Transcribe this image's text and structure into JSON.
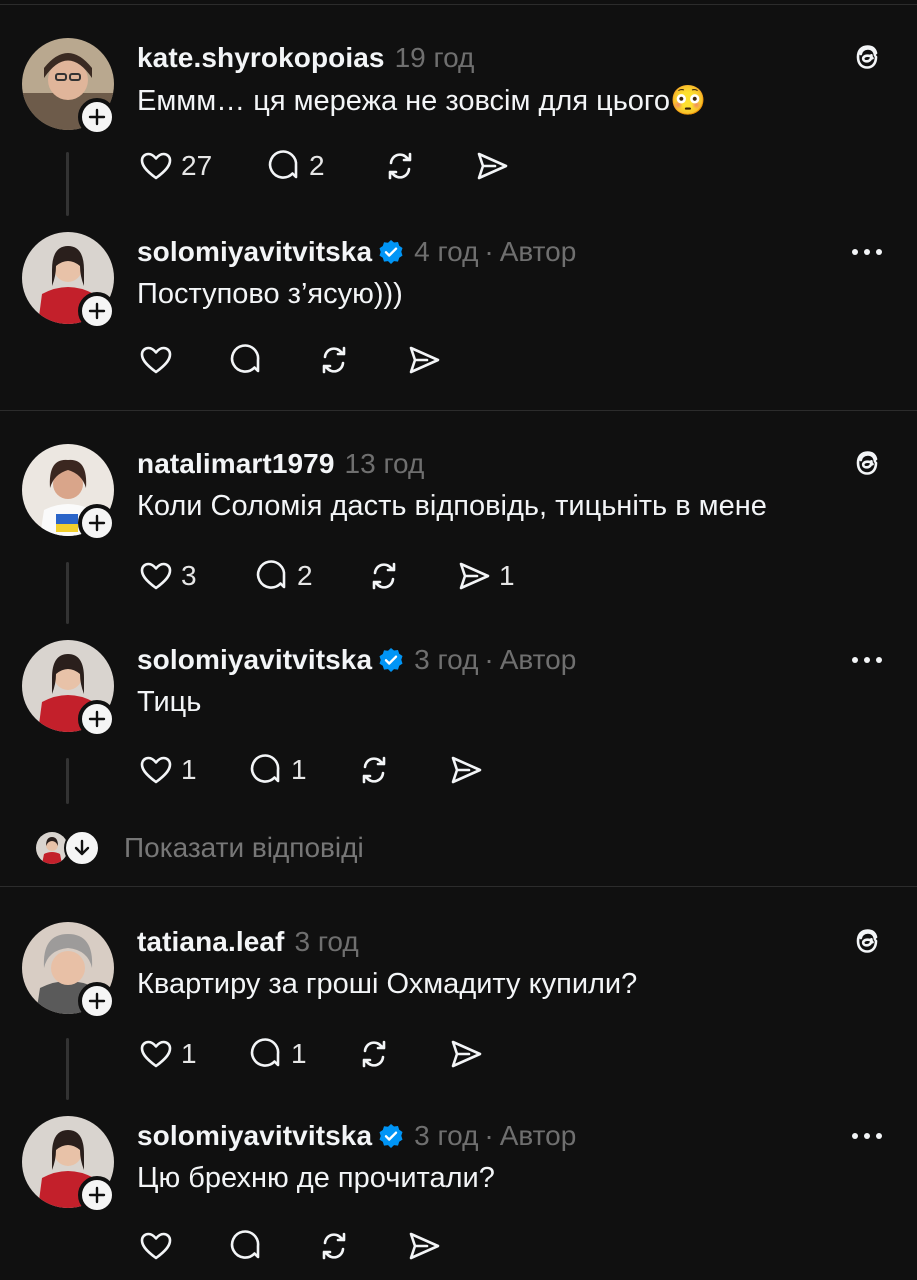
{
  "comments": [
    {
      "id": "c1",
      "username": "kate.shyrokopoias",
      "time": "19 год",
      "text": "Еммм… ця мережа не зовсім для цього😳",
      "likes": "27",
      "replies": "2",
      "reposts": "",
      "shares": "",
      "verified": false,
      "corner_icon": "threads-icon"
    },
    {
      "id": "c2",
      "username": "solomiyavitvitska",
      "time": "4 год",
      "author_label": "Автор",
      "text": "Поступово з’ясую)))",
      "likes": "",
      "replies": "",
      "reposts": "",
      "shares": "",
      "verified": true,
      "corner_icon": "more-icon"
    },
    {
      "id": "c3",
      "username": "natalimart1979",
      "time": "13 год",
      "text": "Коли Соломія дасть відповідь, тицьніть в мене",
      "likes": "3",
      "replies": "2",
      "reposts": "",
      "shares": "1",
      "verified": false,
      "corner_icon": "threads-icon"
    },
    {
      "id": "c4",
      "username": "solomiyavitvitska",
      "time": "3 год",
      "author_label": "Автор",
      "text": "Тиць",
      "likes": "1",
      "replies": "1",
      "reposts": "",
      "shares": "",
      "verified": true,
      "corner_icon": "more-icon"
    },
    {
      "id": "c5",
      "username": "tatiana.leaf",
      "time": "3 год",
      "text": "Квартиру за гроші Охмадиту купили?",
      "likes": "1",
      "replies": "1",
      "reposts": "",
      "shares": "",
      "verified": false,
      "corner_icon": "threads-icon"
    },
    {
      "id": "c6",
      "username": "solomiyavitvitska",
      "time": "3 год",
      "author_label": "Автор",
      "text": "Цю брехню де прочитали?",
      "likes": "",
      "replies": "",
      "reposts": "",
      "shares": "",
      "verified": true,
      "corner_icon": "more-icon"
    }
  ],
  "show_replies": {
    "label": "Показати відповіді"
  },
  "colors": {
    "background": "#101010",
    "text": "#f3f5f7",
    "muted": "#6f6f6f",
    "verified": "#0095f6",
    "separator": "#2c2c2c"
  }
}
